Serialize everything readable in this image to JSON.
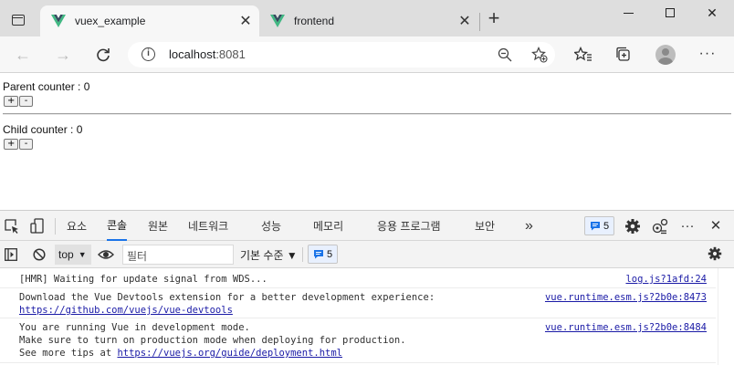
{
  "browser": {
    "tabs": [
      {
        "title": "vuex_example",
        "active": true
      },
      {
        "title": "frontend",
        "active": false
      }
    ],
    "new_tab": "+",
    "window_controls": {
      "minimize": "—",
      "maximize": "☐",
      "close": "✕"
    },
    "address": {
      "host": "localhost",
      "port": ":8081"
    }
  },
  "page": {
    "parent_label": "Parent counter : 0",
    "child_label": "Child counter : 0",
    "plus": "+",
    "minus": "-"
  },
  "devtools": {
    "tabs": [
      "요소",
      "콘솔",
      "원본",
      "네트워크",
      "성능",
      "메모리",
      "응용 프로그램",
      "보안"
    ],
    "selected_tab": "콘솔",
    "more_tabs": "»",
    "issues_count": "5",
    "context": "top",
    "filter_placeholder": "필터",
    "level": "기본 수준 ▼",
    "message_count": "5",
    "messages": [
      {
        "lines": [
          "[HMR] Waiting for update signal from WDS..."
        ],
        "source": "log.js?1afd:24"
      },
      {
        "lines": [
          "Download the Vue Devtools extension for a better development experience:"
        ],
        "link": "https://github.com/vuejs/vue-devtools",
        "source": "vue.runtime.esm.js?2b0e:8473"
      },
      {
        "lines": [
          "You are running Vue in development mode.",
          "Make sure to turn on production mode when deploying for production.",
          "See more tips at "
        ],
        "link": "https://vuejs.org/guide/deployment.html",
        "source": "vue.runtime.esm.js?2b0e:8484"
      }
    ]
  },
  "colors": {
    "accent": "#1a73e8",
    "vue_green": "#41b883",
    "vue_dark": "#35495e"
  }
}
